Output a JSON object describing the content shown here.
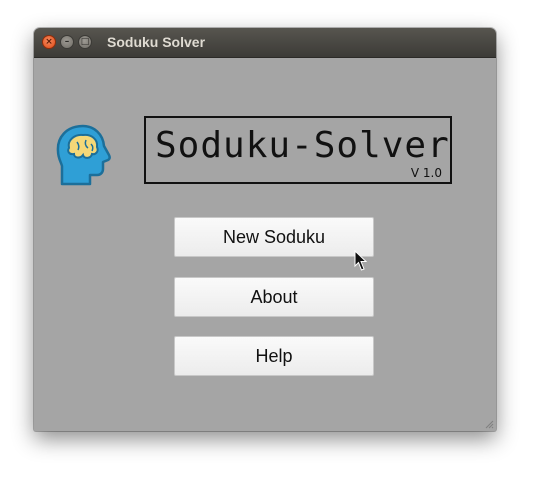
{
  "window": {
    "title": "Soduku Solver",
    "controls": [
      "close",
      "minimize",
      "maximize"
    ]
  },
  "app": {
    "logo_icon": "head-brain-icon",
    "heading": "Soduku-Solver",
    "version": "V 1.0"
  },
  "buttons": {
    "new": "New Soduku",
    "about": "About",
    "help": "Help"
  },
  "colors": {
    "background": "#a5a5a5",
    "titlebar": "#3c3b37",
    "logo_blue": "#2f9fd6",
    "logo_yellow": "#f5d878"
  }
}
